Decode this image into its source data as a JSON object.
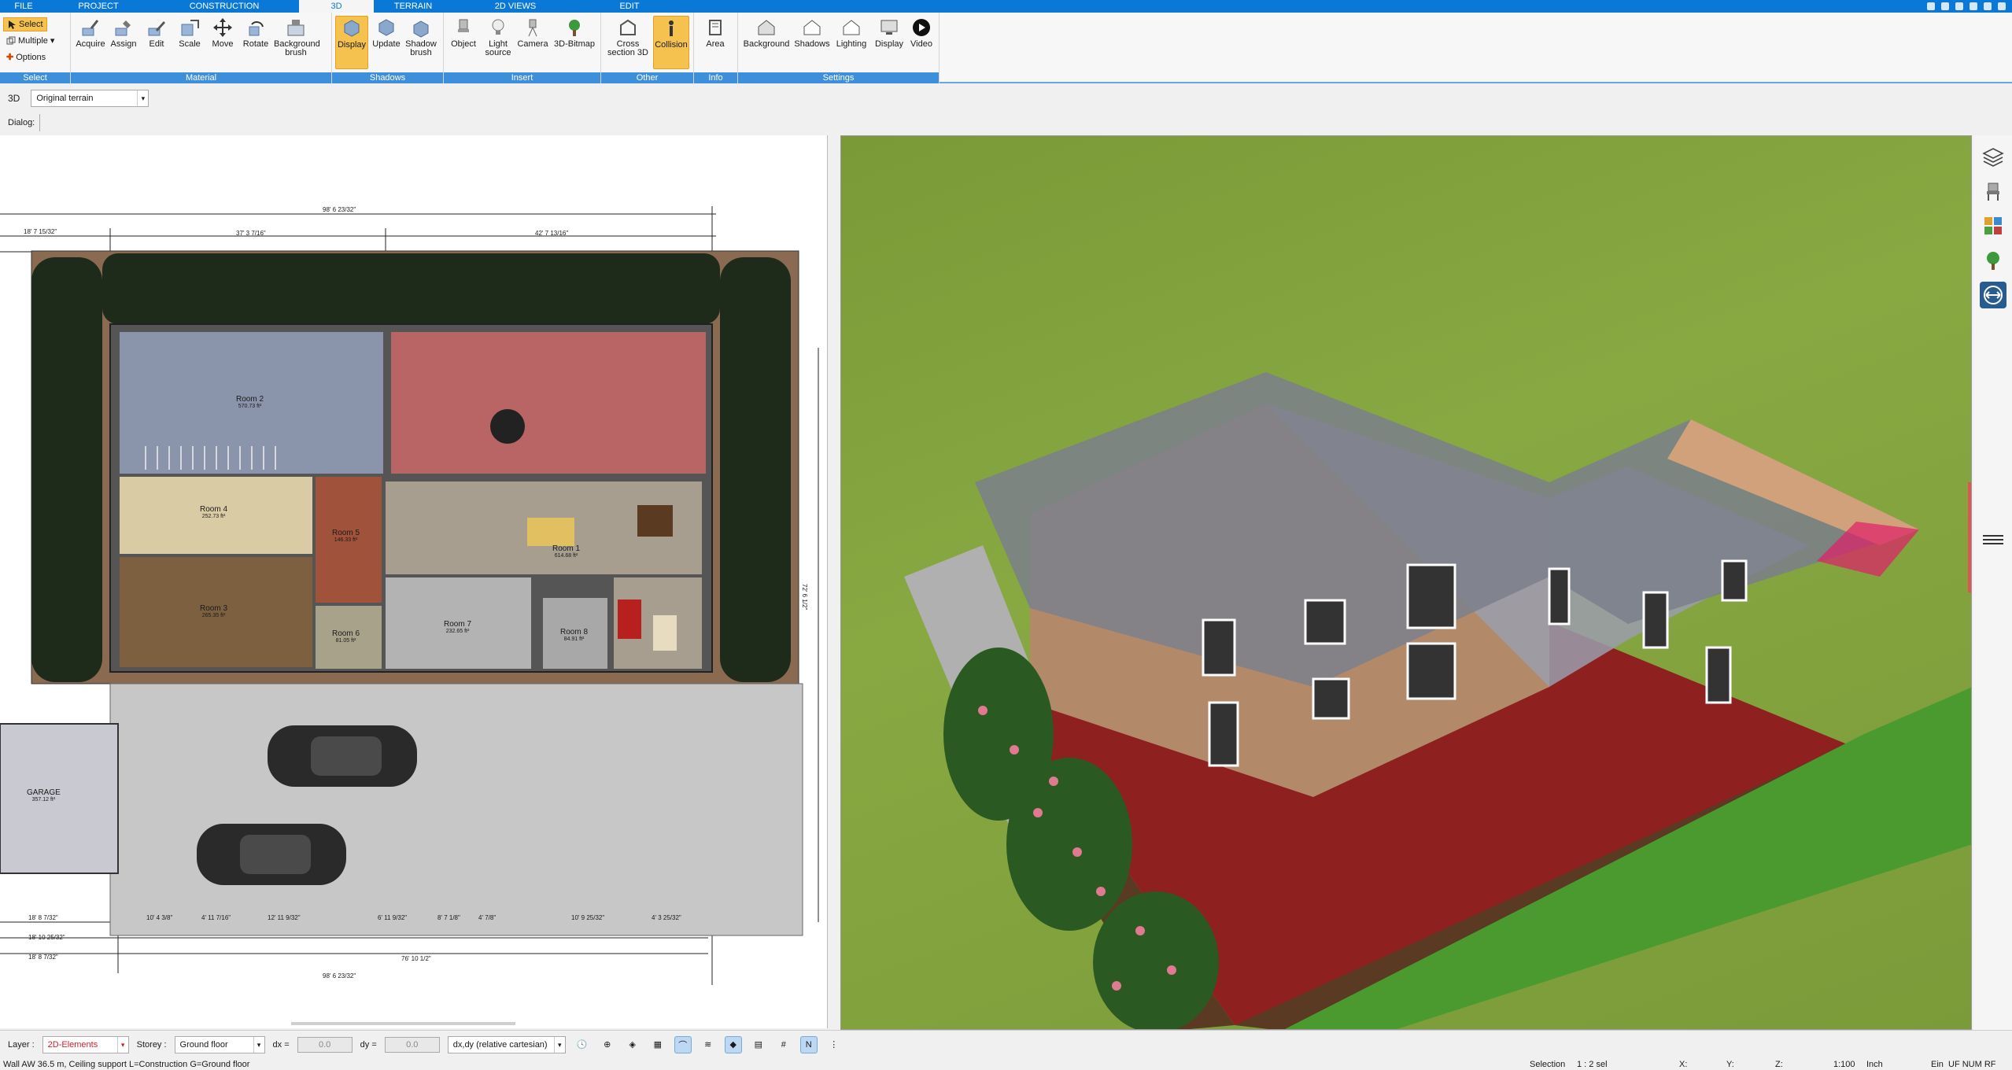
{
  "tabs": [
    {
      "label": "FILE"
    },
    {
      "label": "PROJECT"
    },
    {
      "label": "CONSTRUCTION"
    },
    {
      "label": "3D"
    },
    {
      "label": "TERRAIN"
    },
    {
      "label": "2D VIEWS"
    },
    {
      "label": "EDIT"
    }
  ],
  "ribbon": {
    "select": {
      "select": "Select",
      "multiple": "Multiple",
      "options": "Options",
      "group": "Select"
    },
    "material": {
      "acquire": "Acquire",
      "assign": "Assign",
      "edit": "Edit",
      "scale": "Scale",
      "move": "Move",
      "rotate": "Rotate",
      "background_brush": "Background brush",
      "group": "Material"
    },
    "shadows": {
      "display": "Display",
      "update": "Update",
      "shadow_brush": "Shadow brush",
      "group": "Shadows"
    },
    "insert": {
      "object": "Object",
      "light_source": "Light source",
      "camera": "Camera",
      "bitmap": "3D-Bitmap",
      "group": "Insert"
    },
    "other": {
      "cross_section": "Cross section 3D",
      "collision": "Collision",
      "group": "Other"
    },
    "info": {
      "area": "Area",
      "group": "Info"
    },
    "settings": {
      "background": "Background",
      "shadows": "Shadows",
      "lighting": "Lighting",
      "display": "Display",
      "video": "Video",
      "group": "Settings"
    }
  },
  "optrow": {
    "mode": "3D",
    "terrain": "Original terrain"
  },
  "dialog": {
    "label": "Dialog:"
  },
  "plan": {
    "rooms": [
      {
        "name": "Room 2",
        "area": "570.73 ft²"
      },
      {
        "name": "Room 4",
        "area": "252.73 ft²"
      },
      {
        "name": "Room 3",
        "area": "265.35 ft²"
      },
      {
        "name": "Room 5",
        "area": "146.33 ft²"
      },
      {
        "name": "Room 1",
        "area": "614.68 ft²"
      },
      {
        "name": "Room 6",
        "area": "81.05 ft²"
      },
      {
        "name": "Room 7",
        "area": "232.65 ft²"
      },
      {
        "name": "Room 8",
        "area": "84.91 ft²"
      },
      {
        "name": "GARAGE",
        "area": "357.12 ft²"
      }
    ],
    "dims": {
      "top_total": "98' 6 23/32\"",
      "top_left": "18' 7 15/32\"",
      "top_mid": "37' 3 7/16\"",
      "top_right": "42' 7 13/16\"",
      "bottom_total": "98' 6 23/32\"",
      "bottom_mid": "76' 10 1/2\"",
      "bottom_left1": "18' 8 7/32\"",
      "bottom_left2": "18' 10 25/32\"",
      "bottom_left3": "18' 8 7/32\"",
      "bottom_seg1": "10' 4 3/8\"",
      "bottom_seg2": "4' 11 7/16\"",
      "bottom_seg3": "12' 11 9/32\"",
      "bottom_seg4": "6' 11 9/32\"",
      "bottom_seg5": "8' 7 1/8\"",
      "bottom_seg6": "4' 7/8\"",
      "bottom_seg7": "10' 9 25/32\"",
      "bottom_seg8": "4' 3 25/32\"",
      "right_total": "72' 6 1/2\""
    }
  },
  "bottom": {
    "layer_label": "Layer :",
    "layer_value": "2D-Elements",
    "storey_label": "Storey :",
    "storey_value": "Ground floor",
    "dx_label": "dx =",
    "dx_value": "0.0",
    "dy_label": "dy =",
    "dy_value": "0.0",
    "coord_mode": "dx,dy (relative cartesian)"
  },
  "status": {
    "message": "Wall AW 36.5 m, Ceiling support L=Construction G=Ground floor",
    "selection_label": "Selection",
    "selection_value": "1 : 2 sel",
    "x": "X:",
    "y": "Y:",
    "z": "Z:",
    "scale": "1:100",
    "unit": "Inch",
    "ein": "Ein",
    "keys": "UF NUM RF"
  },
  "colors": {
    "accent": "#0a78d7",
    "ribbon_group": "#3d8fdc",
    "active": "#f6c24f",
    "layer_text": "#d0202a"
  }
}
